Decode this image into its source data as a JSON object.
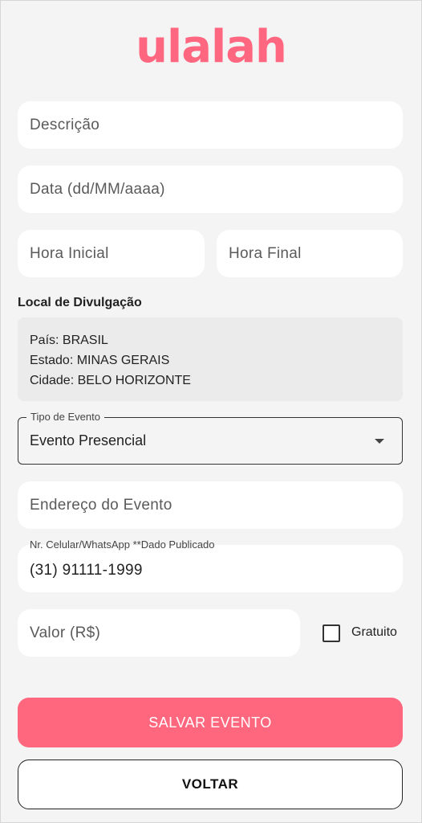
{
  "app": {
    "logo": "ulalah"
  },
  "colors": {
    "brand": "#ff6680",
    "primary_button": "#ff677e"
  },
  "form": {
    "description_placeholder": "Descrição",
    "date_placeholder": "Data (dd/MM/aaaa)",
    "start_time_placeholder": "Hora Inicial",
    "end_time_placeholder": "Hora Final",
    "location_section_label": "Local de Divulgação",
    "location": {
      "country": "País: BRASIL",
      "state": "Estado: MINAS GERAIS",
      "city": "Cidade: BELO HORIZONTE"
    },
    "event_type": {
      "label": "Tipo de Evento",
      "selected": "Evento Presencial",
      "icon": "chevron-down-icon"
    },
    "address_placeholder": "Endereço do Evento",
    "phone": {
      "label": "Nr. Celular/WhatsApp **Dado Publicado",
      "value": "(31) 91111-1999"
    },
    "price_placeholder": "Valor (R$)",
    "free_checkbox": {
      "label": "Gratuito",
      "checked": false
    }
  },
  "actions": {
    "save_label": "SALVAR EVENTO",
    "back_label": "VOLTAR"
  }
}
